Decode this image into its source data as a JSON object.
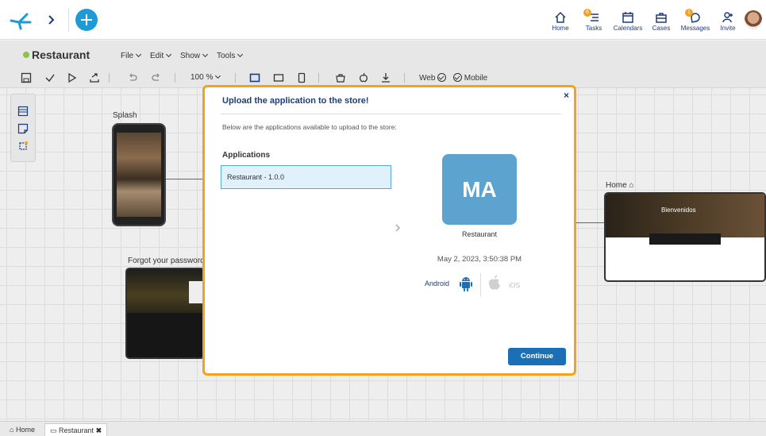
{
  "topnav": {
    "items": [
      {
        "label": "Home",
        "icon": "home-icon"
      },
      {
        "label": "Tasks",
        "icon": "tasks-icon",
        "badge": "6"
      },
      {
        "label": "Calendars",
        "icon": "calendar-icon"
      },
      {
        "label": "Cases",
        "icon": "briefcase-icon"
      },
      {
        "label": "Messages",
        "icon": "messages-icon",
        "badge": "1"
      },
      {
        "label": "Invite",
        "icon": "invite-icon"
      }
    ]
  },
  "app": {
    "name": "Restaurant",
    "status_color": "#8bc34a"
  },
  "menus": [
    "File",
    "Edit",
    "Show",
    "Tools"
  ],
  "toolbar": {
    "zoom": "100 %",
    "web_label": "Web",
    "mobile_label": "Mobile"
  },
  "canvas": {
    "splash_label": "Splash",
    "forgot_label": "Forgot your password",
    "home_label": "Home",
    "home_hero_text": "Bienvenidos"
  },
  "dialog": {
    "title": "Upload the application to the store!",
    "description": "Below are the applications available to upload to the store:",
    "apps_heading": "Applications",
    "app_item": "Restaurant - 1.0.0",
    "app_initials": "MA",
    "app_name": "Restaurant",
    "app_date": "May 2, 2023, 3:50:38 PM",
    "android_label": "Android",
    "ios_label": "iOS",
    "continue_label": "Continue",
    "close_glyph": "×",
    "accent_color": "#f5a21b"
  },
  "bottom_tabs": [
    {
      "label": "Home",
      "icon": "home-icon"
    },
    {
      "label": "Restaurant",
      "icon": "page-icon",
      "close": "✖"
    }
  ]
}
